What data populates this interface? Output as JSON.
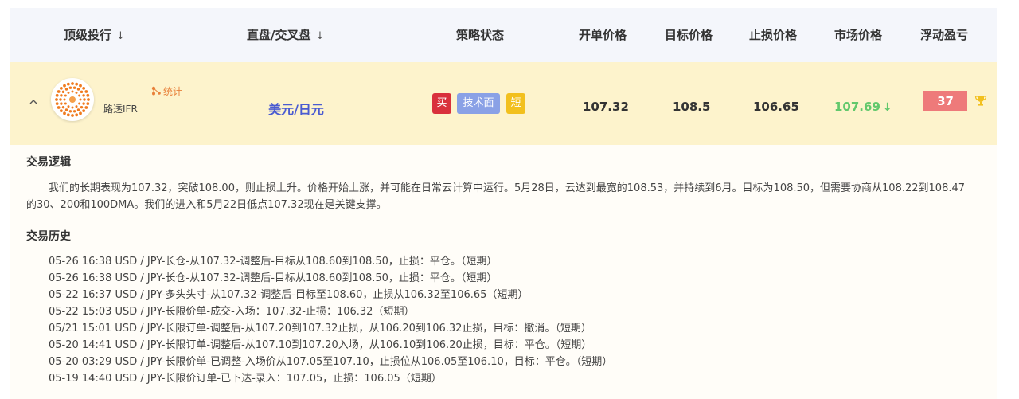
{
  "columns": {
    "top_bank": "顶级投行",
    "pair": "直盘/交叉盘",
    "status": "策略状态",
    "open": "开单价格",
    "target": "目标价格",
    "stop": "止损价格",
    "market": "市场价格",
    "pnl": "浮动盈亏",
    "sort_arrow": "↓"
  },
  "trade": {
    "provider": "路透IFR",
    "stats_label": "统计",
    "pair": "美元/日元",
    "tags": {
      "buy": "买",
      "tech": "技术面",
      "short": "短"
    },
    "open_price": "107.32",
    "target_price": "108.5",
    "stop_price": "106.65",
    "market_price": "107.69",
    "market_arrow": "↓",
    "pnl": "37"
  },
  "colors": {
    "header_bg": "#f4f6fb",
    "row_bg": "#fdf3cc",
    "pair": "#4a5bd1",
    "buy_tag": "#d9303c",
    "tech_tag": "#8aa1e6",
    "short_tag": "#f2c01e",
    "market_up": "#62c86c",
    "pnl_bg": "#ee7a7a",
    "accent": "#e8803a"
  },
  "icons": {
    "expand": "chevron-up-icon",
    "stats": "share-icon",
    "logo": "reuters-logo-icon",
    "trophy": "trophy-icon"
  },
  "logic": {
    "title": "交易逻辑",
    "text": "我们的长期表现为107.32，突破108.00，则止损上升。价格开始上涨，并可能在日常云计算中运行。5月28日，云达到最宽的108.53，并持续到6月。目标为108.50，但需要协商从108.22到108.47的30、200和100DMA。我们的进入和5月22日低点107.32现在是关键支撑。"
  },
  "history": {
    "title": "交易历史",
    "items": [
      "05-26 16:38 USD / JPY-长仓-从107.32-调整后-目标从108.60到108.50，止损：平仓。（短期）",
      "05-26 16:38 USD / JPY-长仓-从107.32-调整后-目标从108.60到108.50，止损：平仓。（短期）",
      "05-22 16:37 USD / JPY-多头头寸-从107.32-调整后-目标至108.60，止损从106.32至106.65（短期）",
      "05-22 15:03 USD / JPY-长限价单-成交-入场：107.32-止损：106.32（短期）",
      "05/21 15:01 USD / JPY-长限订单-调整后-从107.20到107.32止损，从106.20到106.32止损，目标：撤消。（短期）",
      "05-20 14:41 USD / JPY-长限订单-调整后-从107.10到107.20入场，从106.10到106.20止损，目标：平仓。（短期）",
      "05-20 03:29 USD / JPY-长限价单-已调整-入场价从107.05至107.10，止损位从106.05至106.10，目标：平仓。（短期）",
      "05-19 14:40 USD / JPY-长限价订单-已下达-录入：107.05，止损：106.05（短期）"
    ]
  }
}
